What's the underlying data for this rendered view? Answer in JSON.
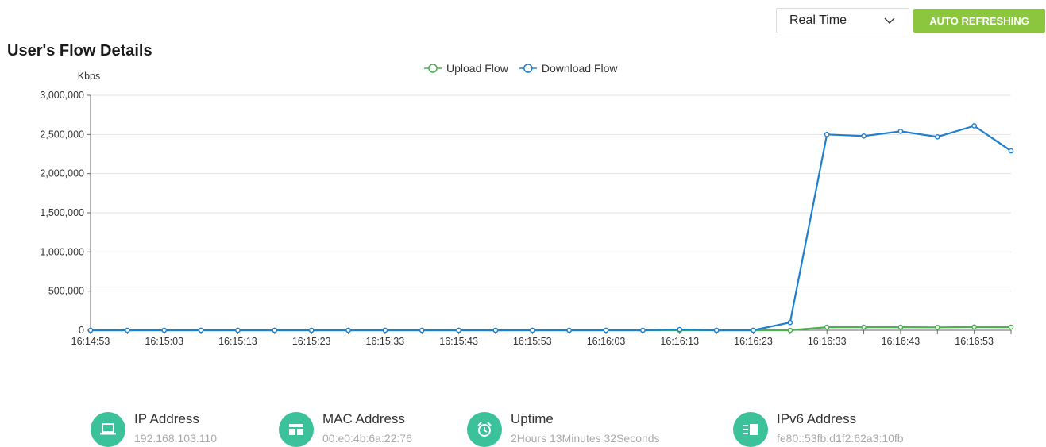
{
  "controls": {
    "mode_select": {
      "value": "Real Time"
    },
    "refresh_button": {
      "label": "AUTO REFRESHING",
      "color": "#8cc63f"
    }
  },
  "title": "User's Flow Details",
  "chart_data": {
    "type": "line",
    "ylabel": "Kbps",
    "ylim": [
      0,
      3000000
    ],
    "y_ticks": [
      0,
      500000,
      1000000,
      1500000,
      2000000,
      2500000,
      3000000
    ],
    "y_tick_labels": [
      "0",
      "500,000",
      "1,000,000",
      "1,500,000",
      "2,000,000",
      "2,500,000",
      "3,000,000"
    ],
    "x": [
      "16:14:53",
      "16:14:58",
      "16:15:03",
      "16:15:08",
      "16:15:13",
      "16:15:18",
      "16:15:23",
      "16:15:28",
      "16:15:33",
      "16:15:38",
      "16:15:43",
      "16:15:48",
      "16:15:53",
      "16:15:58",
      "16:16:03",
      "16:16:08",
      "16:16:13",
      "16:16:18",
      "16:16:23",
      "16:16:28",
      "16:16:33",
      "16:16:38",
      "16:16:43",
      "16:16:48",
      "16:16:53",
      "16:16:58"
    ],
    "x_tick_labels": [
      "16:14:53",
      "16:15:03",
      "16:15:13",
      "16:15:23",
      "16:15:33",
      "16:15:43",
      "16:15:53",
      "16:16:03",
      "16:16:13",
      "16:16:23",
      "16:16:33",
      "16:16:43",
      "16:16:53"
    ],
    "grid": true,
    "legend_position": "top-center",
    "series": [
      {
        "name": "Upload Flow",
        "color": "#4caf50",
        "values": [
          0,
          0,
          0,
          0,
          0,
          0,
          0,
          0,
          0,
          0,
          0,
          0,
          0,
          0,
          0,
          0,
          0,
          0,
          0,
          0,
          40000,
          40000,
          40000,
          38000,
          42000,
          40000
        ]
      },
      {
        "name": "Download Flow",
        "color": "#1e7fd0",
        "values": [
          0,
          0,
          0,
          0,
          0,
          0,
          0,
          0,
          0,
          0,
          0,
          0,
          0,
          0,
          0,
          0,
          10000,
          0,
          0,
          100000,
          2500000,
          2480000,
          2540000,
          2470000,
          2610000,
          2290000
        ]
      }
    ]
  },
  "info": [
    {
      "icon": "laptop-icon",
      "label": "IP Address",
      "value": "192.168.103.110"
    },
    {
      "icon": "mac-card-icon",
      "label": "MAC Address",
      "value": "00:e0:4b:6a:22:76"
    },
    {
      "icon": "alarm-clock-icon",
      "label": "Uptime",
      "value": "2Hours 13Minutes 32Seconds"
    },
    {
      "icon": "ipv6-card-icon",
      "label": "IPv6 Address",
      "value": "fe80::53fb:d1f2:62a3:10fb"
    }
  ],
  "icon_color": "#3cc29b"
}
